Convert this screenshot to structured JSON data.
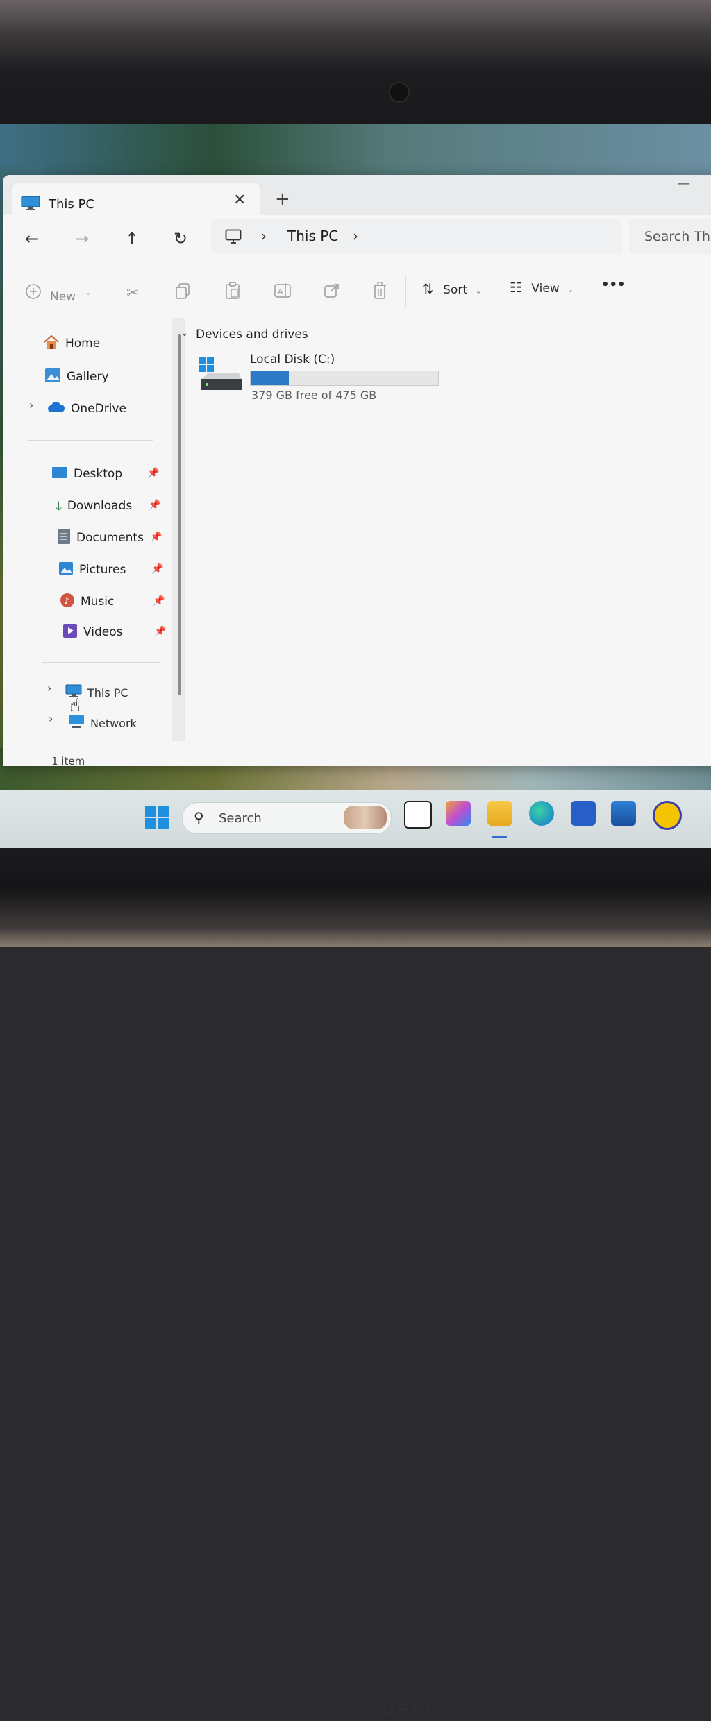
{
  "window": {
    "tab_title": "This PC",
    "tab_close": "✕",
    "new_tab": "+",
    "minimize": "—"
  },
  "nav": {
    "back_icon": "←",
    "forward_icon": "→",
    "up_icon": "↑",
    "refresh_icon": "↻",
    "breadcrumb_sep": "›",
    "breadcrumb_current": "This PC",
    "breadcrumb_trailing_sep": "›",
    "search_placeholder": "Search This"
  },
  "command_bar": {
    "new_label": "New",
    "sort_label": "Sort",
    "view_label": "View",
    "more_label": "•••"
  },
  "sidebar": {
    "items": [
      {
        "label": "Home",
        "icon": "home-icon"
      },
      {
        "label": "Gallery",
        "icon": "gallery-icon"
      },
      {
        "label": "OneDrive",
        "icon": "cloud-icon"
      },
      {
        "label": "Desktop",
        "icon": "desktop-icon",
        "pinned": true
      },
      {
        "label": "Downloads",
        "icon": "download-icon",
        "pinned": true
      },
      {
        "label": "Documents",
        "icon": "document-icon",
        "pinned": true
      },
      {
        "label": "Pictures",
        "icon": "pictures-icon",
        "pinned": true
      },
      {
        "label": "Music",
        "icon": "music-icon",
        "pinned": true
      },
      {
        "label": "Videos",
        "icon": "video-icon",
        "pinned": true
      },
      {
        "label": "This PC",
        "icon": "pc-icon",
        "selected": true
      },
      {
        "label": "Network",
        "icon": "network-icon"
      }
    ]
  },
  "content": {
    "group_header": "Devices and drives",
    "drive": {
      "name": "Local Disk (C:)",
      "free_text": "379 GB free of 475 GB",
      "used_fraction": 0.202
    }
  },
  "status": {
    "item_count": "1 item"
  },
  "taskbar": {
    "search_label": "Search",
    "accent_color": "#2a6fd1"
  },
  "colors": {
    "drive_bar_fill": "#2a7ac7",
    "selection_bg": "#cfe3f7"
  }
}
